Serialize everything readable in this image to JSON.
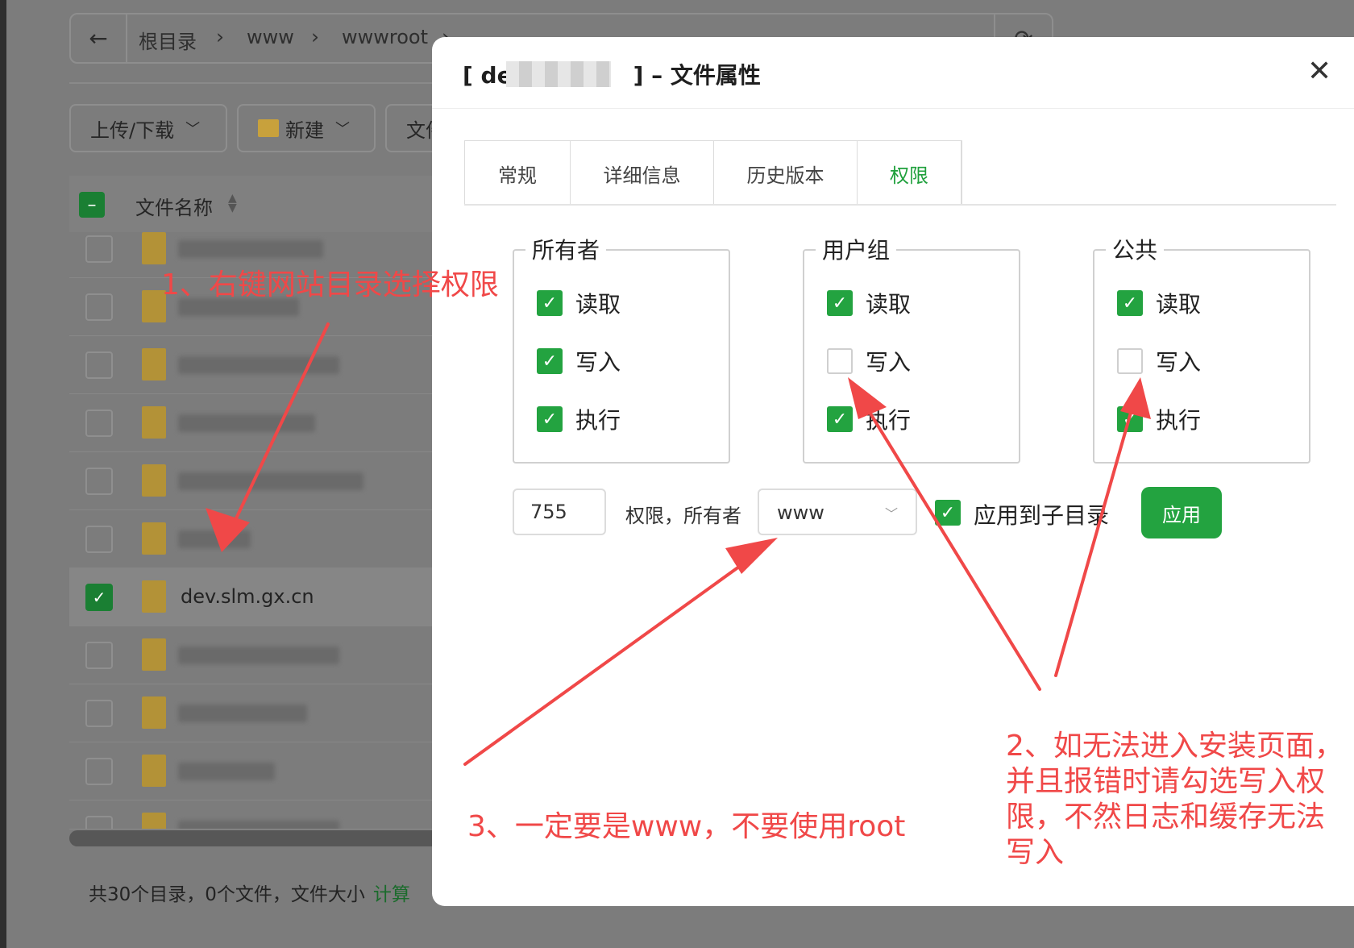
{
  "breadcrumb": {
    "root": "根目录",
    "seg1": "www",
    "seg2": "wwwroot"
  },
  "toolbar": {
    "upload": "上传/下载",
    "new": "新建",
    "file": "文件"
  },
  "table": {
    "header": "文件名称",
    "selected_row_name": "dev.slm.gx.cn"
  },
  "footer": {
    "summary": "共30个目录，0个文件，文件大小",
    "calc": "计算"
  },
  "modal": {
    "title_prefix": "[ de",
    "title_suffix": "] – 文件属性",
    "tabs": [
      "常规",
      "详细信息",
      "历史版本",
      "权限"
    ],
    "active_tab": "权限",
    "groups": [
      {
        "name": "所有者",
        "read": "读取",
        "write": "写入",
        "exec": "执行",
        "read_checked": true,
        "write_checked": true,
        "exec_checked": true
      },
      {
        "name": "用户组",
        "read": "读取",
        "write": "写入",
        "exec": "执行",
        "read_checked": true,
        "write_checked": false,
        "exec_checked": true
      },
      {
        "name": "公共",
        "read": "读取",
        "write": "写入",
        "exec": "执行",
        "read_checked": true,
        "write_checked": false,
        "exec_checked": true
      }
    ],
    "octal_value": "755",
    "owner_label": "权限，所有者",
    "owner_value": "www",
    "apply_subdir_label": "应用到子目录",
    "apply_button": "应用"
  },
  "annotations": {
    "a1": "1、右键网站目录选择权限",
    "a2_line1": "2、如无法进入安装页面，",
    "a2_line2": "并且报错时请勾选写入权",
    "a2_line3": "限，不然日志和缓存无法",
    "a2_line4": "写入",
    "a3": "3、一定要是www，不要使用root"
  },
  "colors": {
    "accent": "#23a340",
    "annotation": "#f04848",
    "overlay": "#7c7c7c"
  }
}
